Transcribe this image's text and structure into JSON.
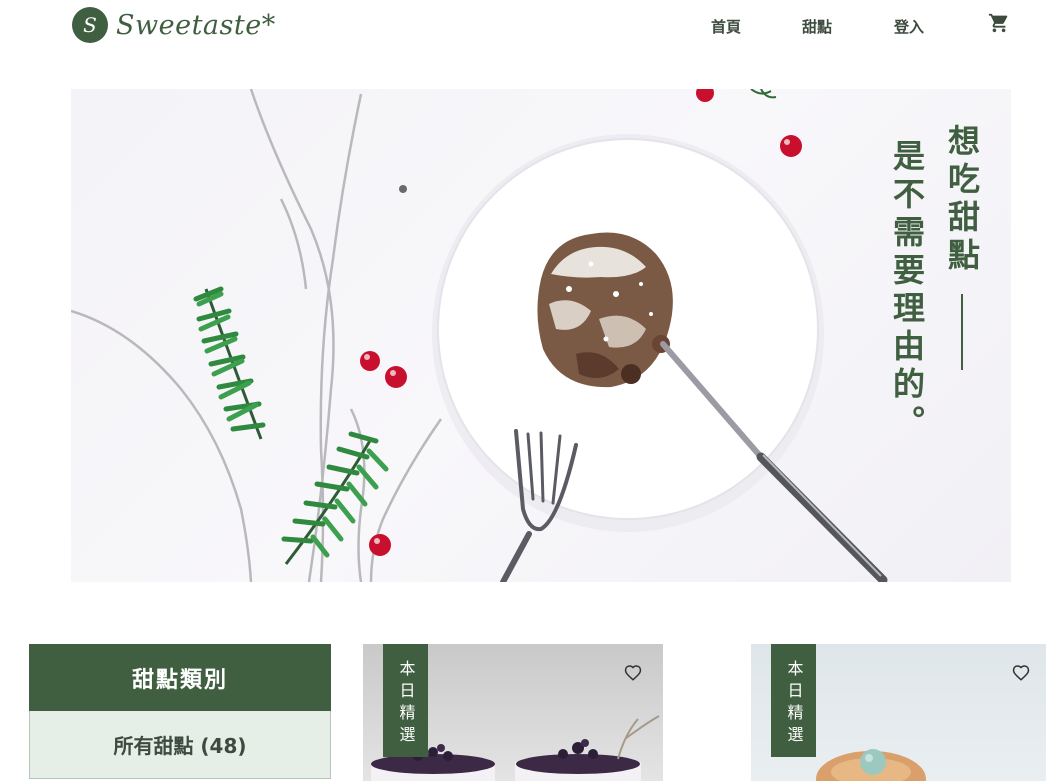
{
  "header": {
    "logo_letter": "S",
    "brand": "Sweetaste*",
    "nav": [
      {
        "label": "首頁"
      },
      {
        "label": "甜點"
      },
      {
        "label": "登入"
      }
    ],
    "cart_icon": "cart-icon"
  },
  "hero": {
    "slogan_line1": "想吃甜點",
    "slogan_line2": "是不需要理由的。"
  },
  "sidebar": {
    "title": "甜點類別",
    "items": [
      {
        "label": "所有甜點 (48)"
      }
    ]
  },
  "cards": [
    {
      "badge": "本日精選",
      "favorite_icon": "heart-icon"
    },
    {
      "badge": "本日精選",
      "favorite_icon": "heart-icon"
    }
  ],
  "colors": {
    "brand_green": "#3f5f40",
    "light_green": "#e6eee8",
    "berry_red": "#c8102e"
  }
}
